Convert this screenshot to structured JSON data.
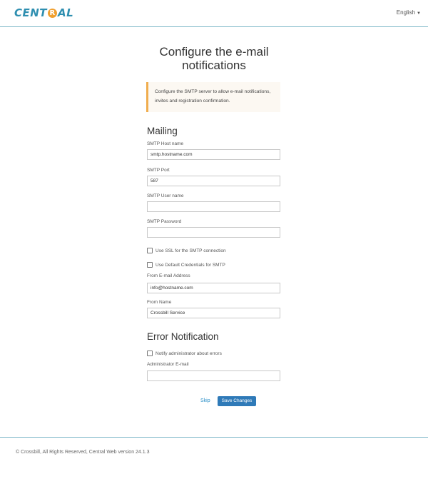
{
  "header": {
    "logo_text_before": "CENT",
    "logo_mark": "R",
    "logo_text_after": "AL",
    "language": "English"
  },
  "page": {
    "title": "Configure the e-mail notifications",
    "alert": "Configure the SMTP server to allow e-mail notifications, invites and registration confirmation."
  },
  "mailing": {
    "heading": "Mailing",
    "smtp_host_label": "SMTP Host name",
    "smtp_host_value": "smtp.hostname.com",
    "smtp_port_label": "SMTP Port",
    "smtp_port_value": "587",
    "smtp_user_label": "SMTP User name",
    "smtp_user_value": "",
    "smtp_password_label": "SMTP Password",
    "smtp_password_value": "",
    "use_ssl_label": "Use SSL for the SMTP connection",
    "use_ssl_checked": false,
    "default_creds_label": "Use Default Credentials for SMTP",
    "default_creds_checked": false,
    "from_email_label": "From E-mail Address",
    "from_email_value": "info@hostname.com",
    "from_name_label": "From Name",
    "from_name_value": "Crossbill Service"
  },
  "errors": {
    "heading": "Error Notification",
    "notify_label": "Notify administrator about errors",
    "notify_checked": false,
    "admin_email_label": "Administrator E-mail",
    "admin_email_value": ""
  },
  "actions": {
    "skip_label": "Skip",
    "save_label": "Save Changes"
  },
  "footer": {
    "copyright": "© Crossbill, All Rights Reserved, Central Web version 24.1.3"
  },
  "colors": {
    "accent": "#2f7ab8",
    "link": "#2a8fc8",
    "alert_border": "#f0ad4e",
    "logo_blue": "#2f8fb0",
    "logo_orange": "#f0a030"
  }
}
